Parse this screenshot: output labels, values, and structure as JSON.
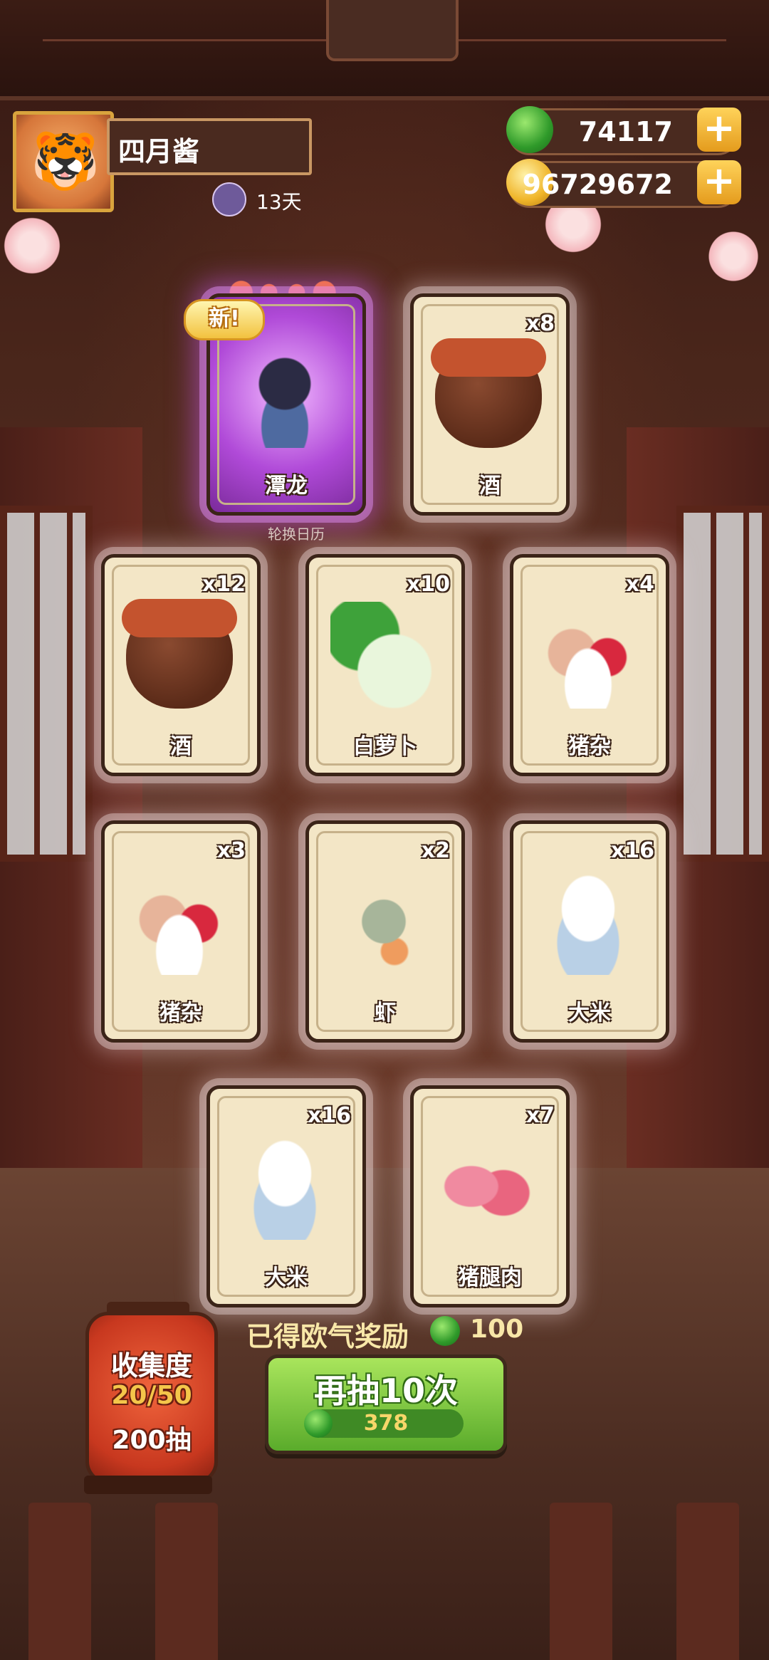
{
  "player": {
    "name": "四月酱",
    "days": "13天"
  },
  "currency": {
    "gems": "74117",
    "gold": "96729672",
    "plus_label": "+"
  },
  "featured_cards": [
    {
      "name": "潭龙",
      "is_new": true,
      "new_label": "新!",
      "flames": 4,
      "art": "dragon-icon"
    },
    {
      "name": "酒",
      "qty": "x8",
      "art": "wine-jar-icon"
    }
  ],
  "sub_label": "轮换日历",
  "cards": [
    {
      "name": "酒",
      "qty": "x12",
      "art": "wine-jar-icon"
    },
    {
      "name": "白萝卜",
      "qty": "x10",
      "art": "radish-icon"
    },
    {
      "name": "猪杂",
      "qty": "x4",
      "art": "pork-offal-icon"
    },
    {
      "name": "猪杂",
      "qty": "x3",
      "art": "pork-offal-icon"
    },
    {
      "name": "虾",
      "qty": "x2",
      "art": "shrimp-icon"
    },
    {
      "name": "大米",
      "qty": "x16",
      "art": "rice-bowl-icon"
    },
    {
      "name": "大米",
      "qty": "x16",
      "art": "rice-bowl-icon"
    },
    {
      "name": "猪腿肉",
      "qty": "x7",
      "art": "pork-leg-icon"
    }
  ],
  "reward": {
    "label": "已得欧气奖励",
    "value": "100"
  },
  "draw_button": {
    "label": "再抽10次",
    "cost": "378"
  },
  "collection": {
    "title": "收集度",
    "progress": "20/50",
    "draws": "200抽"
  },
  "colors": {
    "accent_green": "#5aab2b",
    "gold": "#f0b52a",
    "card_bg": "#f3e6c6",
    "new_glow": "#b04ad8"
  }
}
